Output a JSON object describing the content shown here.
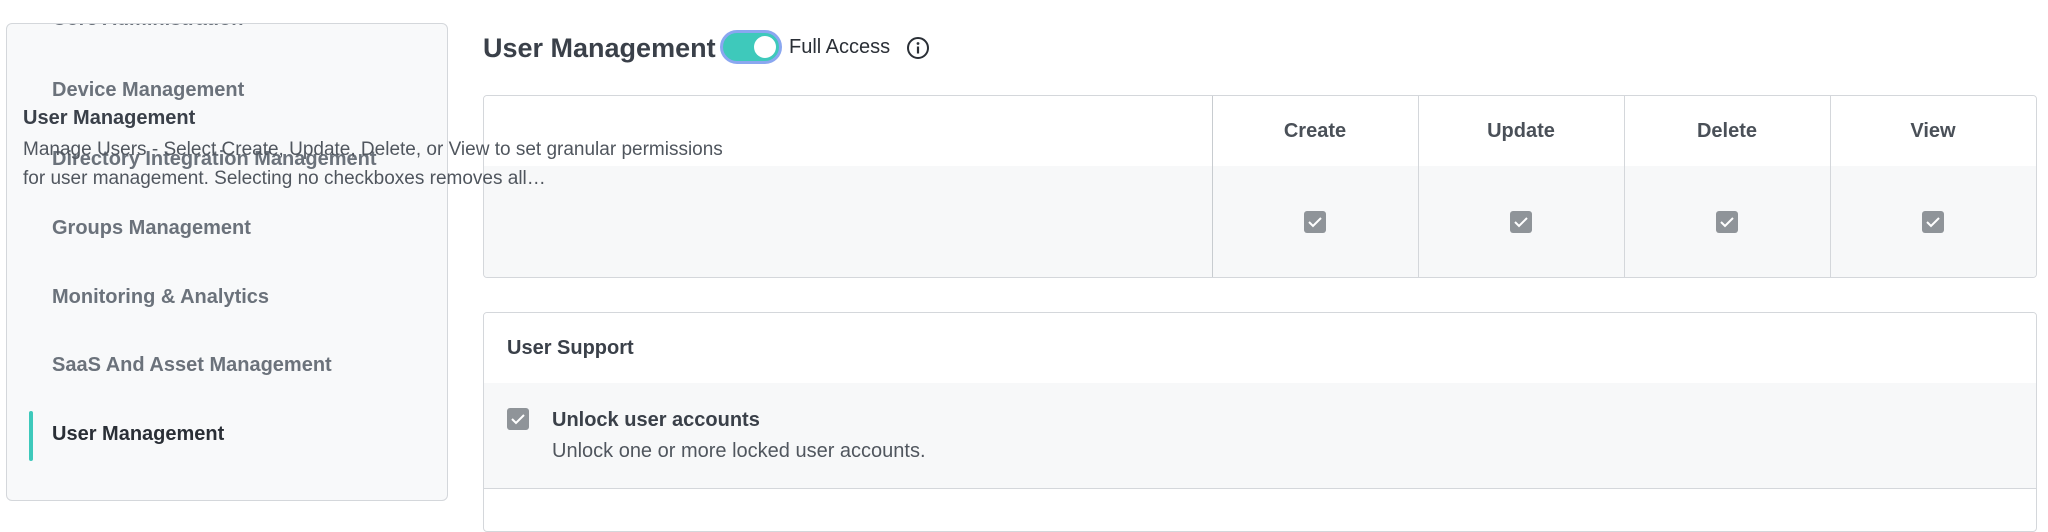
{
  "sidebar": {
    "items": [
      {
        "label": "Core Administration",
        "active": false
      },
      {
        "label": "Device Management",
        "active": false
      },
      {
        "label": "Directory Integration Management",
        "active": false
      },
      {
        "label": "Groups Management",
        "active": false
      },
      {
        "label": "Monitoring & Analytics",
        "active": false
      },
      {
        "label": "SaaS And Asset Management",
        "active": false
      },
      {
        "label": "User Management",
        "active": true
      }
    ]
  },
  "header": {
    "title": "User Management",
    "full_access_label": "Full Access",
    "full_access_on": true,
    "info_icon": "info-icon"
  },
  "permissions": {
    "columns": [
      "Create",
      "Update",
      "Delete",
      "View"
    ],
    "row": {
      "title": "User Management",
      "description": "Manage Users - Select Create, Update, Delete, or View to set granular permissions for user management. Selecting no checkboxes removes all…",
      "create": true,
      "update": true,
      "delete": true,
      "view": true
    }
  },
  "support": {
    "title": "User Support",
    "items": [
      {
        "title": "Unlock user accounts",
        "description": "Unlock one or more locked user accounts.",
        "checked": true
      }
    ]
  },
  "colors": {
    "accent": "#3ec9bb",
    "toggle_focus_ring": "#8aa7f0",
    "checkbox": "#8f9499"
  }
}
